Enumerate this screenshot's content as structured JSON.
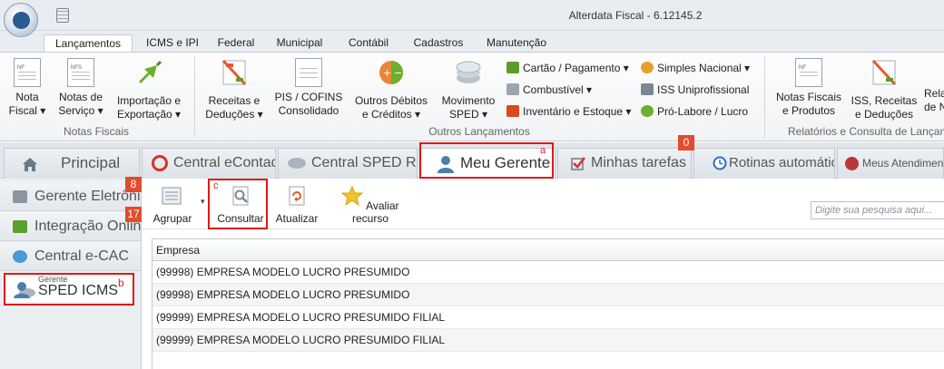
{
  "window": {
    "title": "Alterdata Fiscal - 6.12145.2"
  },
  "ribbon_tabs": [
    "Lançamentos",
    "ICMS e IPI",
    "Federal",
    "Municipal",
    "Contábil",
    "Cadastros",
    "Manutenção"
  ],
  "ribbon": {
    "nota_fiscal": [
      "Nota",
      "Fiscal ▾"
    ],
    "notas_servico": [
      "Notas de",
      "Serviço ▾"
    ],
    "importacao": [
      "Importação e",
      "Exportação ▾"
    ],
    "group_notas": "Notas Fiscais",
    "receitas": [
      "Receitas e",
      "Deduções ▾"
    ],
    "pis_cofins": [
      "PIS / COFINS",
      "Consolidado"
    ],
    "outros_debitos": [
      "Outros Débitos",
      "e Créditos ▾"
    ],
    "movimento_sped": [
      "Movimento",
      "SPED ▾"
    ],
    "small_left": [
      "Cartão / Pagamento ▾",
      "Combustível ▾",
      "Inventário e Estoque ▾"
    ],
    "small_right": [
      "Simples Nacional ▾",
      "ISS Uniprofissional",
      "Pró-Labore / Lucro"
    ],
    "group_outros": "Outros Lançamentos",
    "notas_produtos": [
      "Notas Fiscais",
      "e Produtos"
    ],
    "iss_receitas": [
      "ISS, Receitas",
      "e Deduções"
    ],
    "relatorios_partial": [
      "Rela",
      "de N"
    ],
    "group_relatorios": "Relatórios e Consulta de Lançam"
  },
  "workspace_tabs": {
    "principal": "Principal",
    "central_econtador": "Central eContador",
    "central_sped": "Central SPED Reinf",
    "meu_gerente": "Meu Gerente",
    "minhas_tarefas": "Minhas tarefas",
    "rotinas": "Rotinas automáticas",
    "meus_atendimentos": "Meus Atendimento",
    "tarefas_badge": "0"
  },
  "annotations": {
    "a": "a",
    "b": "b",
    "c": "c"
  },
  "left_panel": {
    "items": [
      "Gerente Eletrônico",
      "Integração Online",
      "Central e-CAC"
    ],
    "badges": [
      "8",
      "17"
    ],
    "selected_small": "Gerente",
    "selected_label": "SPED ICMS"
  },
  "toolbar": {
    "agrupar": "Agrupar",
    "consultar": "Consultar",
    "atualizar": "Atualizar",
    "avaliar": "Avaliar recurso",
    "search_placeholder": "Digite sua pesquisa aqui..."
  },
  "grid": {
    "header": "Empresa",
    "rows": [
      "(99998) EMPRESA MODELO LUCRO PRESUMIDO",
      "(99998) EMPRESA MODELO LUCRO PRESUMIDO",
      "(99999) EMPRESA MODELO LUCRO PRESUMIDO FILIAL",
      "(99999) EMPRESA MODELO LUCRO PRESUMIDO FILIAL"
    ]
  },
  "colors": {
    "accent_red": "#e01818",
    "badge_orange": "#e34b2b"
  }
}
